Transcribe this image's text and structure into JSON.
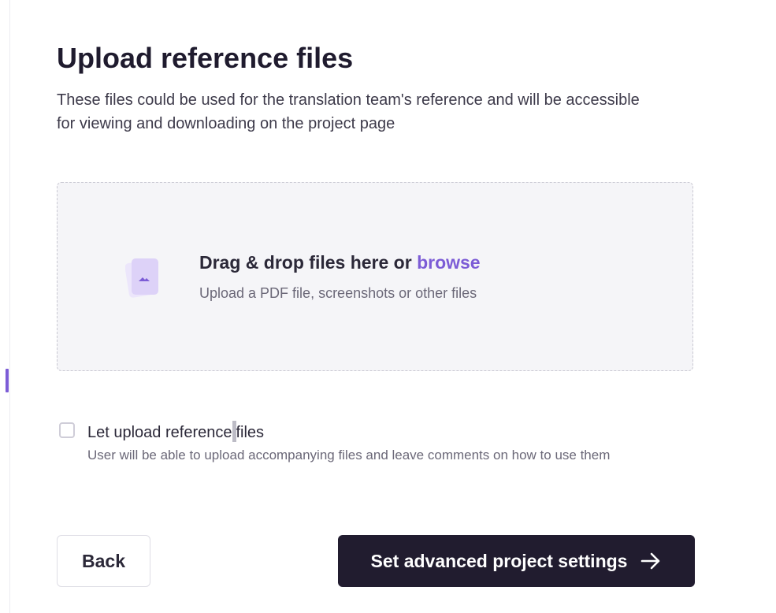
{
  "page": {
    "title": "Upload reference files",
    "description": "These files could be used for the translation team's reference and will be accessible for viewing and downloading on the project page"
  },
  "dropzone": {
    "title_prefix": "Drag & drop files here or ",
    "browse_label": "browse",
    "hint": "Upload a PDF file, screenshots or other files",
    "icon": "file-stack-icon"
  },
  "option": {
    "checked": false,
    "label_part1": "Let upload reference",
    "label_part2": "files",
    "help": "User will be able to upload accompanying files and leave comments on how to use them"
  },
  "actions": {
    "back_label": "Back",
    "next_label": "Set advanced project settings",
    "next_icon": "arrow-right-icon"
  },
  "colors": {
    "accent": "#7c5cd6",
    "primary_button": "#211c2f",
    "dropzone_bg": "#f5f5f8"
  }
}
